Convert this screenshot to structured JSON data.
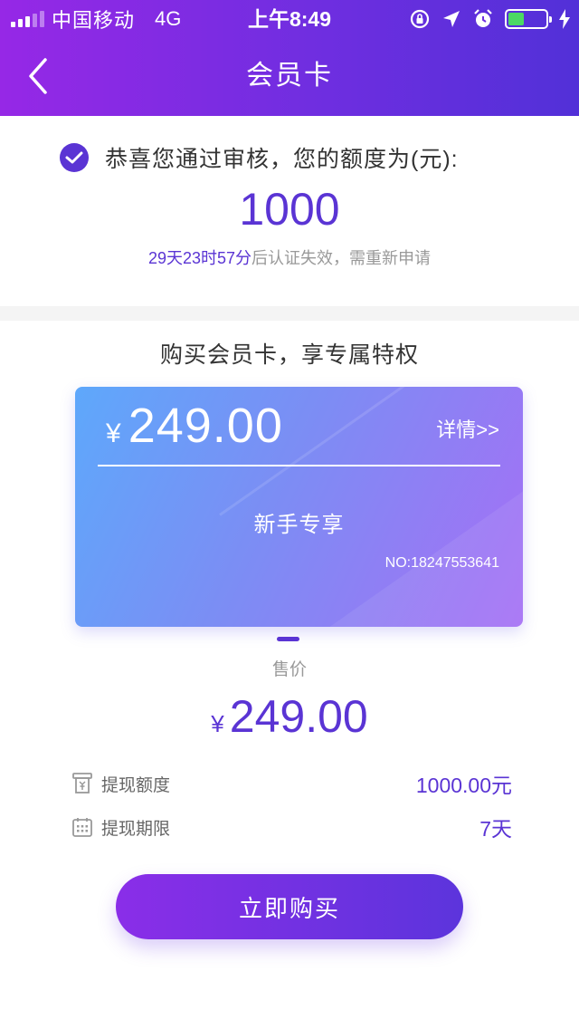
{
  "status_bar": {
    "carrier": "中国移动",
    "network": "4G",
    "time": "上午8:49",
    "battery_color": "#4cd964"
  },
  "nav": {
    "title": "会员卡",
    "back_icon": "chevron-left-icon"
  },
  "approval": {
    "message": "恭喜您通过审核，您的额度为(元):",
    "amount": "1000",
    "countdown": "29天23时57分",
    "expire_note": "后认证失效，需重新申请"
  },
  "membership": {
    "section_title": "购买会员卡，享专属特权",
    "card": {
      "currency": "¥",
      "price": "249.00",
      "detail_link": "详情>>",
      "name": "新手专享",
      "number": "NO:18247553641"
    },
    "sale_label": "售价",
    "sale_currency": "¥",
    "sale_price": "249.00",
    "details": [
      {
        "icon": "withdraw-icon",
        "label": "提现额度",
        "value": "1000.00元"
      },
      {
        "icon": "calendar-icon",
        "label": "提现期限",
        "value": "7天"
      }
    ],
    "buy_label": "立即购买"
  },
  "colors": {
    "accent": "#5a34d4",
    "header_start": "#9628e6",
    "header_end": "#5230d8",
    "card_start": "#5ea8fb",
    "card_end": "#a56ff5"
  }
}
